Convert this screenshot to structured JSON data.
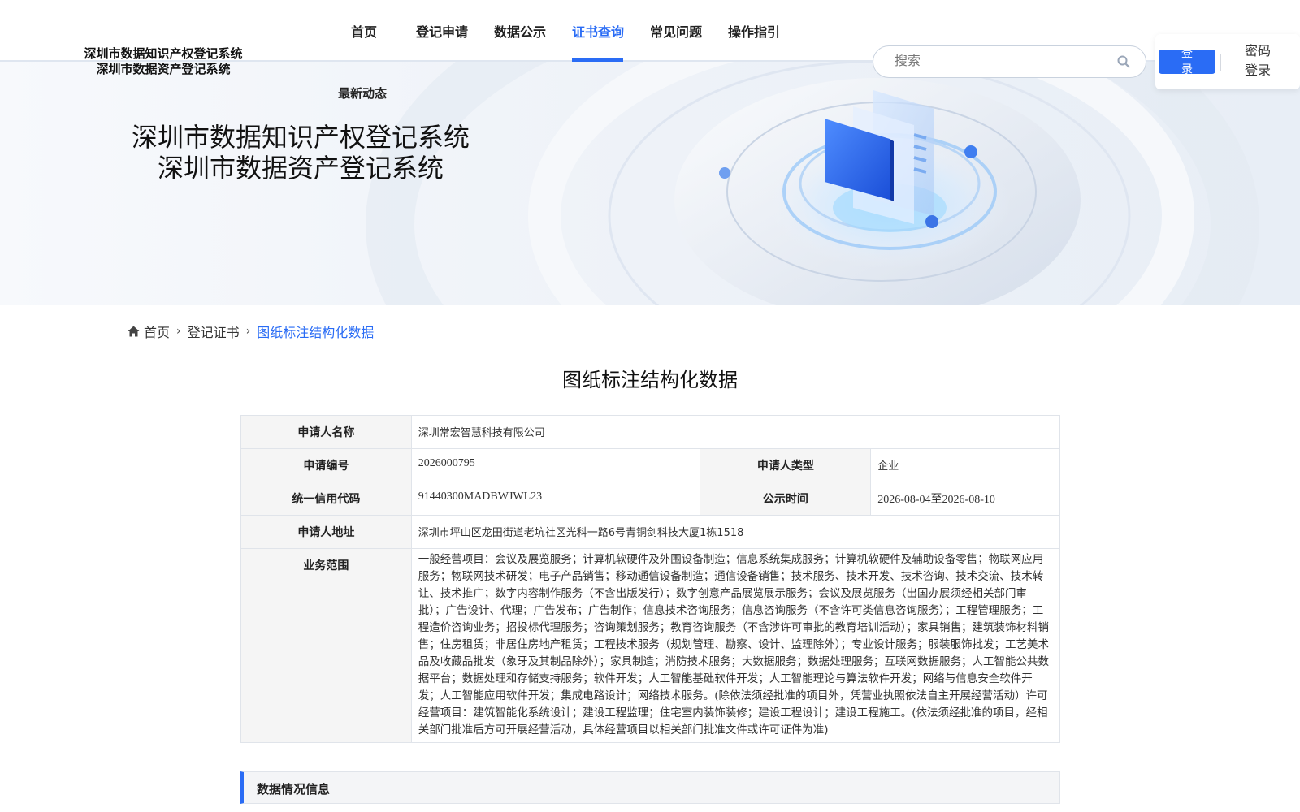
{
  "site": {
    "title_line1": "深圳市数据知识产权登记系统",
    "title_line2": "深圳市数据资产登记系统"
  },
  "nav": {
    "items": [
      {
        "label": "首页",
        "active": false
      },
      {
        "label": "登记申请",
        "active": false
      },
      {
        "label": "数据公示",
        "active": false
      },
      {
        "label": "证书查询",
        "active": true
      },
      {
        "label": "常见问题",
        "active": false
      },
      {
        "label": "操作指引",
        "active": false
      }
    ],
    "latest": "最新动态"
  },
  "search": {
    "placeholder": "搜索",
    "icon": "search-icon"
  },
  "auth": {
    "login_label": "登录",
    "password_login_label": "密码登录"
  },
  "banner": {
    "title_line1": "深圳市数据知识产权登记系统",
    "title_line2": "深圳市数据资产登记系统"
  },
  "breadcrumb": {
    "home_icon": "home-icon",
    "items": [
      "首页",
      "登记证书",
      "图纸标注结构化数据"
    ]
  },
  "page": {
    "title": "图纸标注结构化数据"
  },
  "details": {
    "applicant_name_label": "申请人名称",
    "applicant_name": "深圳常宏智慧科技有限公司",
    "application_no_label": "申请编号",
    "application_no": "2026000795",
    "applicant_type_label": "申请人类型",
    "applicant_type": "企业",
    "credit_code_label": "统一信用代码",
    "credit_code": "91440300MADBWJWL23",
    "publicity_label": "公示时间",
    "publicity_period": "2026-08-04至2026-08-10",
    "address_label": "申请人地址",
    "address": "深圳市坪山区龙田街道老坑社区光科一路6号青铜剑科技大厦1栋1518",
    "scope_label": "业务范围",
    "scope": "一般经营项目：会议及展览服务；计算机软硬件及外围设备制造；信息系统集成服务；计算机软硬件及辅助设备零售；物联网应用服务；物联网技术研发；电子产品销售；移动通信设备制造；通信设备销售；技术服务、技术开发、技术咨询、技术交流、技术转让、技术推广；数字内容制作服务（不含出版发行）；数字创意产品展览展示服务；会议及展览服务（出国办展须经相关部门审批）；广告设计、代理；广告发布；广告制作；信息技术咨询服务；信息咨询服务（不含许可类信息咨询服务）；工程管理服务；工程造价咨询业务；招投标代理服务；咨询策划服务；教育咨询服务（不含涉许可审批的教育培训活动）；家具销售；建筑装饰材料销售；住房租赁；非居住房地产租赁；工程技术服务（规划管理、勘察、设计、监理除外）；专业设计服务；服装服饰批发；工艺美术品及收藏品批发（象牙及其制品除外）；家具制造；消防技术服务；大数据服务；数据处理服务；互联网数据服务；人工智能公共数据平台；数据处理和存储支持服务；软件开发；人工智能基础软件开发；人工智能理论与算法软件开发；网络与信息安全软件开发；人工智能应用软件开发；集成电路设计；网络技术服务。(除依法须经批准的项目外，凭营业执照依法自主开展经营活动）许可经营项目：建筑智能化系统设计；建设工程监理；住宅室内装饰装修；建设工程设计；建设工程施工。(依法须经批准的项目，经相关部门批准后方可开展经营活动，具体经营项目以相关部门批准文件或许可证件为准)"
  },
  "section": {
    "data_info_label": "数据情况信息"
  },
  "colors": {
    "accent": "#2a6cf5"
  }
}
